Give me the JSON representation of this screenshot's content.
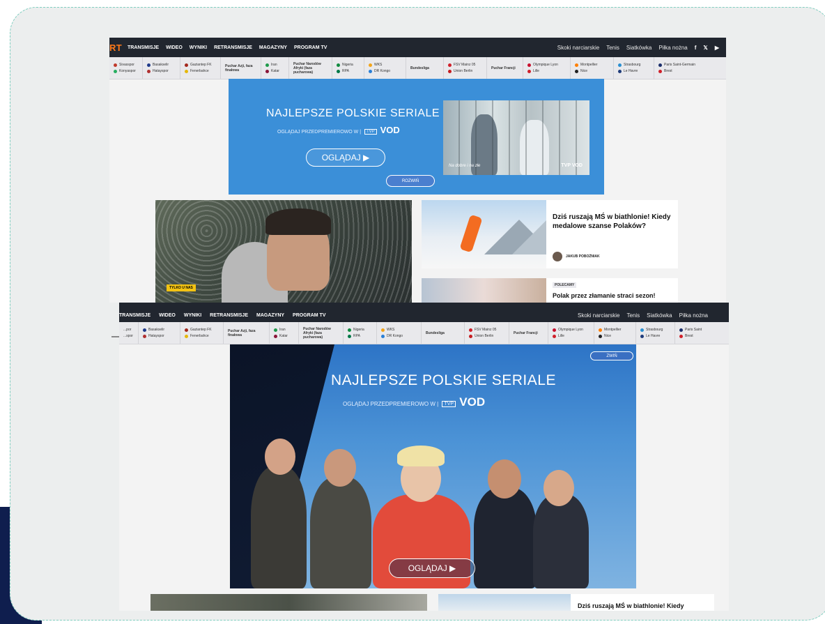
{
  "nav": {
    "logo_fragment": "RT",
    "items": [
      "TRANSMISJE",
      "WIDEO",
      "WYNIKI",
      "RETRANSMISJE",
      "MAGAZYNY",
      "PROGRAM TV"
    ],
    "right_items": [
      "Skoki narciarskie",
      "Tenis",
      "Siatkówka",
      "Piłka nożna"
    ],
    "social": [
      "f",
      "𝕏",
      "▶"
    ]
  },
  "subnav": {
    "matches": [
      {
        "home": "Sivasspor",
        "away": "Konyaspor"
      },
      {
        "home": "Basakselir",
        "away": "Hatayspor"
      },
      {
        "home": "Gaziantep FK",
        "away": "Fenerbahce"
      },
      {
        "league": "Puchar Azji, faza finałowa"
      },
      {
        "home": "Iran",
        "away": "Katar"
      },
      {
        "league": "Puchar Narodów Afryki (faza pucharowa)"
      },
      {
        "home": "Nigeria",
        "away": "RPA"
      },
      {
        "home": "WKS",
        "away": "DR Kongo"
      },
      {
        "league": "Bundesliga"
      },
      {
        "home": "FSV Mainz 05",
        "away": "Union Berlin"
      },
      {
        "league": "Puchar Francji"
      },
      {
        "home": "Olympique Lyon",
        "away": "Lille"
      },
      {
        "home": "Montpellier",
        "away": "Nice"
      },
      {
        "home": "Strasbourg",
        "away": "Le Havre"
      },
      {
        "home": "Paris Saint-Germain",
        "away": "Brest"
      }
    ],
    "matches2": [
      {
        "home": "...por",
        "away": "...spor"
      },
      {
        "home": "Basakselir",
        "away": "Hatayspor"
      },
      {
        "home": "Gaziantep FK",
        "away": "Fenerbahce"
      },
      {
        "league": "Puchar Azji, faza finałowa"
      },
      {
        "home": "Iran",
        "away": "Katar"
      },
      {
        "league": "Puchar Narodów Afryki (faza pucharowa)"
      },
      {
        "home": "Nigeria",
        "away": "RPA"
      },
      {
        "home": "WKS",
        "away": "DR Kongo"
      },
      {
        "league": "Bundesliga"
      },
      {
        "home": "FSV Mainz 05",
        "away": "Union Berlin"
      },
      {
        "league": "Puchar Francji"
      },
      {
        "home": "Olympique Lyon",
        "away": "Lille"
      },
      {
        "home": "Montpellier",
        "away": "Nice"
      },
      {
        "home": "Strasbourg",
        "away": "Le Havre"
      },
      {
        "home": "Paris Saint",
        "away": "Brest"
      }
    ]
  },
  "ad_small": {
    "title": "NAJLEPSZE POLSKIE SERIALE",
    "sub": "OGLĄDAJ PRZEDPREMIEROWO W",
    "tvp": "TVP",
    "vod": "VOD",
    "watch": "OGLĄDAJ ▶",
    "expand": "ROZWIŃ",
    "caption": "Na dobre i na złe",
    "photo_vod": "TVP VOD"
  },
  "hero": {
    "badge": "TYLKO U NAS"
  },
  "card1": {
    "title": "Dziś ruszają MŚ w biathlonie! Kiedy medalowe szanse Polaków?",
    "author": "JAKUB POBOŻNIAK"
  },
  "card2": {
    "tag": "POLECAMY",
    "title": "Polak przez złamanie straci sezon!"
  },
  "ad_large": {
    "title": "NAJLEPSZE POLSKIE SERIALE",
    "sub": "OGLĄDAJ PRZEDPREMIEROWO W",
    "tvp": "TVP",
    "vod": "VOD",
    "watch": "OGLĄDAJ ▶",
    "close": "ZWIŃ"
  },
  "bottom": {
    "title": "Dziś ruszają MŚ w biathlonie! Kiedy"
  },
  "colors": {
    "nav_bg": "#21262f",
    "ad_blue": "#3b8fd8",
    "frame": "#eceeee",
    "brand_orange": "#ff7a1a"
  }
}
